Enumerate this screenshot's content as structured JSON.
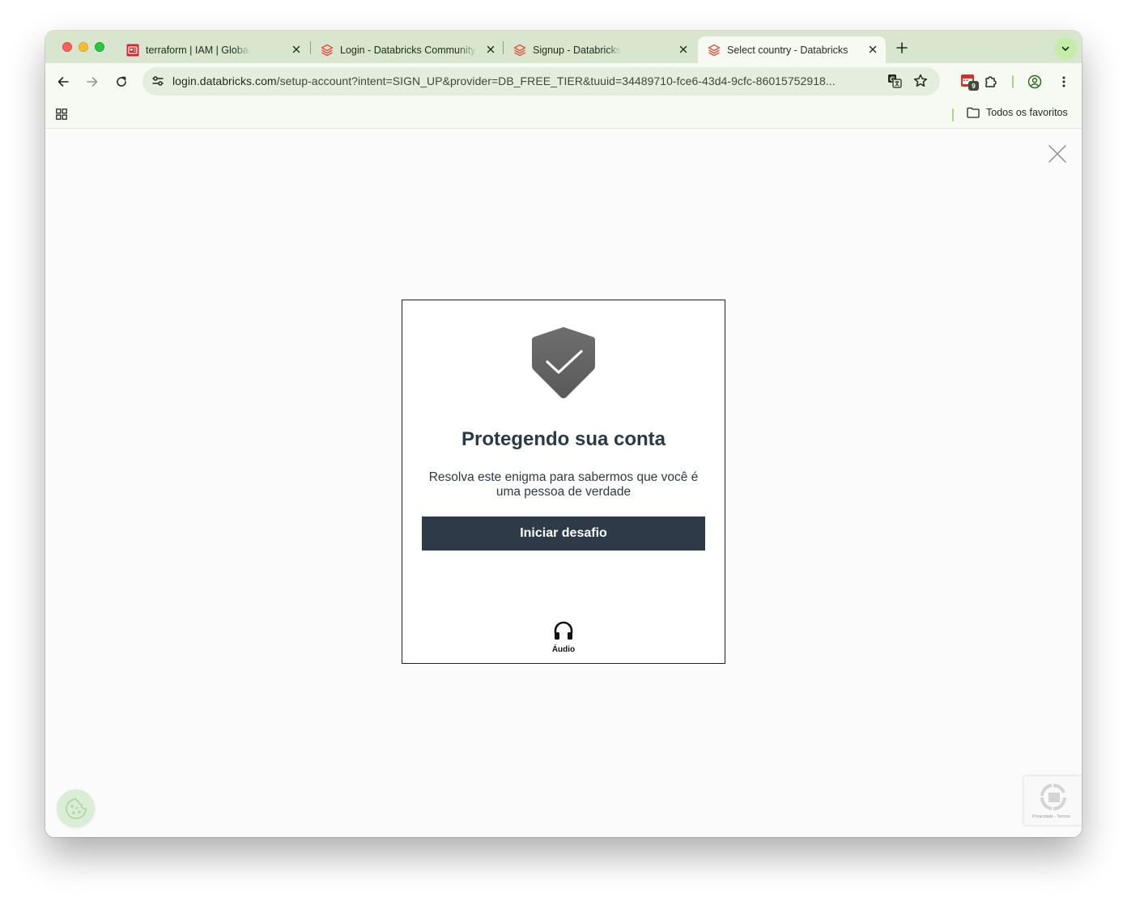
{
  "browser": {
    "tabs": [
      {
        "title": "terraform | IAM | Global",
        "favicon": "aws-console-icon",
        "active": false
      },
      {
        "title": "Login - Databricks Community Edition",
        "favicon": "databricks-icon",
        "active": false
      },
      {
        "title": "Signup - Databricks",
        "favicon": "databricks-icon",
        "active": false
      },
      {
        "title": "Select country - Databricks",
        "favicon": "databricks-icon",
        "active": true
      }
    ],
    "address": {
      "host": "login.databricks.com",
      "path": "/setup-account?intent=SIGN_UP&provider=DB_FREE_TIER&tuuid=34489710-fce6-43d4-9cfc-86015752918..."
    },
    "extension_badge": "9",
    "bookmarks_folder": "Todos os favoritos"
  },
  "challenge": {
    "title": "Protegendo sua conta",
    "description": "Resolva este enigma para sabermos que você é uma pessoa de verdade",
    "button_label": "Iniciar desafio",
    "audio_label": "Áudio"
  },
  "recaptcha": {
    "footer_text": "Privacidade - Termos"
  },
  "colors": {
    "tabstrip": "#d8e6cf",
    "toolbar": "#f7faf3",
    "button_bg": "#2e3a47",
    "heading_text": "#2c3a46",
    "tabsearch_accent": "#c4edaa"
  }
}
